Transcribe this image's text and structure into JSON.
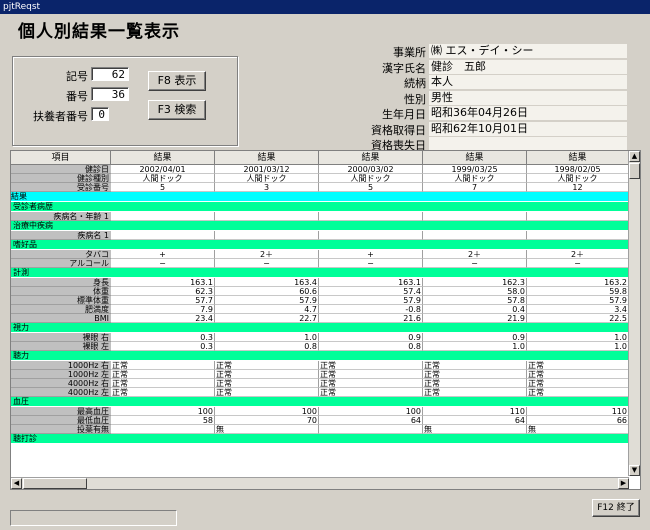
{
  "window_title": "pjtReqst",
  "heading": "個人別結果一覧表示",
  "form": {
    "kigo_label": "記号",
    "kigo_value": "62",
    "bango_label": "番号",
    "bango_value": "36",
    "fuyo_label": "扶養者番号",
    "fuyo_value": "0",
    "f8_label": "F8 表示",
    "f3_label": "F3 検索"
  },
  "info": [
    {
      "label": "事業所",
      "value": "㈱ エス・デイ・シー"
    },
    {
      "label": "漢字氏名",
      "value": "健診　五郎"
    },
    {
      "label": "続柄",
      "value": "本人"
    },
    {
      "label": "性別",
      "value": "男性"
    },
    {
      "label": "生年月日",
      "value": "昭和36年04月26日"
    },
    {
      "label": "資格取得日",
      "value": "昭和62年10月01日"
    },
    {
      "label": "資格喪失日",
      "value": ""
    }
  ],
  "grid": {
    "col_header": "項目",
    "result_header": "結果",
    "rows": [
      {
        "type": "data",
        "key": "健診日",
        "vals": [
          "2002/04/01",
          "2001/03/12",
          "2000/03/02",
          "1999/03/25",
          "1998/02/05"
        ],
        "align": "center"
      },
      {
        "type": "data",
        "key": "健診種別",
        "vals": [
          "人間ドック",
          "人間ドック",
          "人間ドック",
          "人間ドック",
          "人間ドック"
        ],
        "align": "center"
      },
      {
        "type": "data",
        "key": "受診番号",
        "vals": [
          "5",
          "3",
          "5",
          "7",
          "12"
        ],
        "align": "center"
      },
      {
        "type": "cyan",
        "label": "結果"
      },
      {
        "type": "sec",
        "label": "受診者病歴"
      },
      {
        "type": "data",
        "key": "疾病名・年齢 1",
        "vals": [
          "",
          "",
          "",
          "",
          ""
        ],
        "align": "left"
      },
      {
        "type": "sec",
        "label": "治療中疾病"
      },
      {
        "type": "data",
        "key": "疾病名 1",
        "vals": [
          "",
          "",
          "",
          "",
          ""
        ],
        "align": "left"
      },
      {
        "type": "sec",
        "label": "嗜好品"
      },
      {
        "type": "data",
        "key": "タバコ",
        "vals": [
          "+",
          "2＋",
          "+",
          "2＋",
          "2＋"
        ],
        "align": "center"
      },
      {
        "type": "data",
        "key": "アルコール",
        "vals": [
          "−",
          "−",
          "−",
          "−",
          "−"
        ],
        "align": "center"
      },
      {
        "type": "sec",
        "label": "計測"
      },
      {
        "type": "data",
        "key": "身長",
        "vals": [
          "163.1",
          "163.4",
          "163.1",
          "162.3",
          "163.2"
        ],
        "align": "right"
      },
      {
        "type": "data",
        "key": "体重",
        "vals": [
          "62.3",
          "60.6",
          "57.4",
          "58.0",
          "59.8"
        ],
        "align": "right"
      },
      {
        "type": "data",
        "key": "標準体重",
        "vals": [
          "57.7",
          "57.9",
          "57.9",
          "57.8",
          "57.9"
        ],
        "align": "right"
      },
      {
        "type": "data",
        "key": "肥満度",
        "vals": [
          "7.9",
          "4.7",
          "-0.8",
          "0.4",
          "3.4"
        ],
        "align": "right"
      },
      {
        "type": "data",
        "key": "BMI",
        "vals": [
          "23.4",
          "22.7",
          "21.6",
          "21.9",
          "22.5"
        ],
        "align": "right"
      },
      {
        "type": "sec",
        "label": "視力"
      },
      {
        "type": "data",
        "key": "裸眼 右",
        "vals": [
          "0.3",
          "1.0",
          "0.9",
          "0.9",
          "1.0"
        ],
        "align": "right"
      },
      {
        "type": "data",
        "key": "裸眼 左",
        "vals": [
          "0.3",
          "0.8",
          "0.8",
          "1.0",
          "1.0"
        ],
        "align": "right"
      },
      {
        "type": "sec",
        "label": "聴力"
      },
      {
        "type": "data",
        "key": "1000Hz 右",
        "vals": [
          "正常",
          "正常",
          "正常",
          "正常",
          "正常"
        ],
        "align": "left"
      },
      {
        "type": "data",
        "key": "1000Hz 左",
        "vals": [
          "正常",
          "正常",
          "正常",
          "正常",
          "正常"
        ],
        "align": "left"
      },
      {
        "type": "data",
        "key": "4000Hz 右",
        "vals": [
          "正常",
          "正常",
          "正常",
          "正常",
          "正常"
        ],
        "align": "left"
      },
      {
        "type": "data",
        "key": "4000Hz 左",
        "vals": [
          "正常",
          "正常",
          "正常",
          "正常",
          "正常"
        ],
        "align": "left"
      },
      {
        "type": "sec",
        "label": "血圧"
      },
      {
        "type": "data",
        "key": "最高血圧",
        "vals": [
          "100",
          "100",
          "100",
          "110",
          "110"
        ],
        "align": "right"
      },
      {
        "type": "data",
        "key": "最低血圧",
        "vals": [
          "58",
          "70",
          "64",
          "64",
          "66"
        ],
        "align": "right"
      },
      {
        "type": "data",
        "key": "投薬有無",
        "vals": [
          "",
          "無",
          "",
          "無",
          "無"
        ],
        "align": "left"
      },
      {
        "type": "sec",
        "label": "聴打診"
      }
    ]
  },
  "f12_label": "F12 終了"
}
